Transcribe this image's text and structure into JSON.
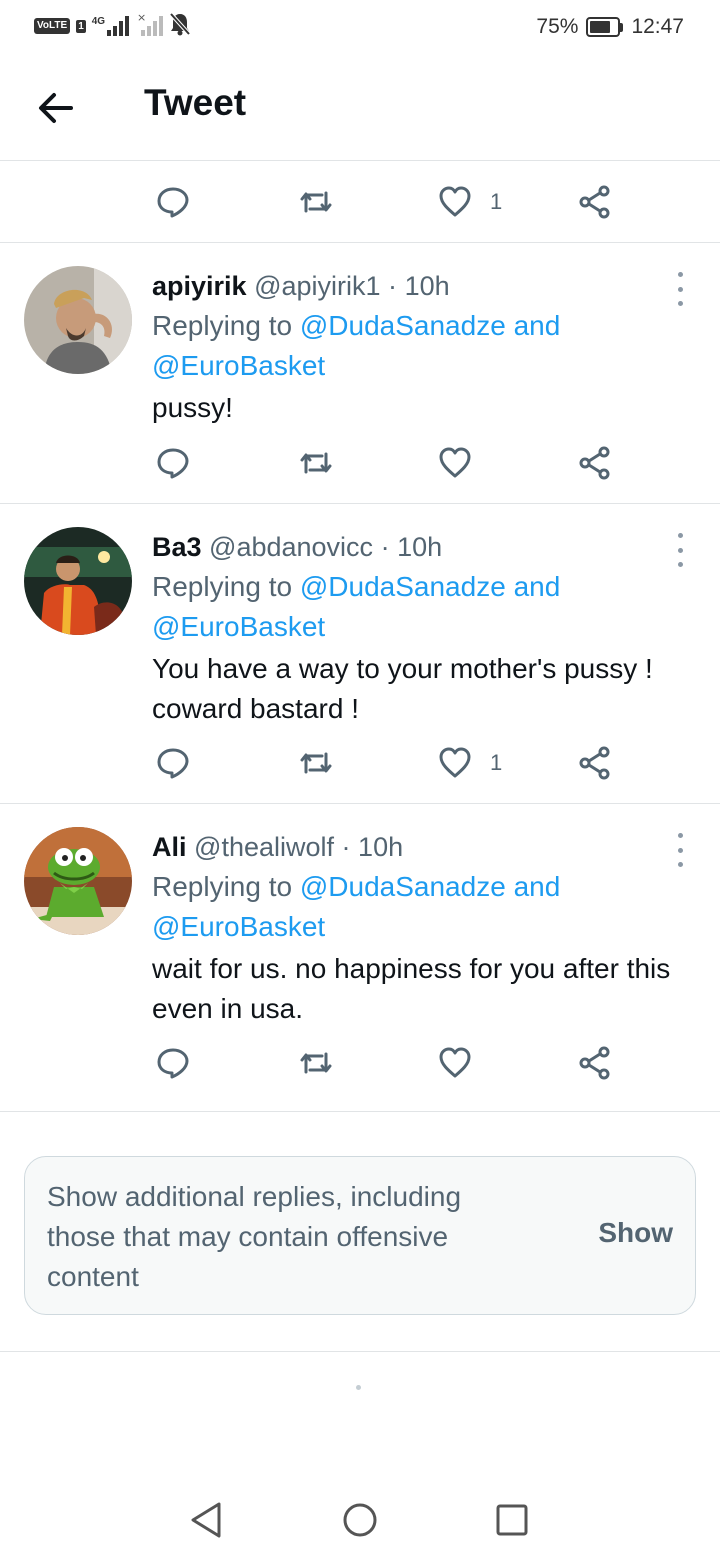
{
  "status_bar": {
    "volte": "VoLTE",
    "sim": "1",
    "network": "4G",
    "battery_percent": "75%",
    "battery_level": 0.75,
    "time": "12:47",
    "icons": [
      "signal-icon",
      "signal-off-icon",
      "mute-icon",
      "battery-icon"
    ]
  },
  "header": {
    "title": "Tweet",
    "back_icon": "arrow-left-icon"
  },
  "main_tweet_actions": {
    "like_count": "1"
  },
  "tweets": [
    {
      "name": "apiyirik",
      "handle": "@apiyirik1",
      "separator": "·",
      "time": "10h",
      "replying_prefix": "Replying to",
      "mention_1": "@DudaSanadze",
      "and": "and",
      "mention_2": "@EuroBasket",
      "text": "pussy!",
      "like_count": ""
    },
    {
      "name": "Ba3",
      "handle": "@abdanovicc",
      "separator": "·",
      "time": "10h",
      "replying_prefix": "Replying to",
      "mention_1": "@DudaSanadze",
      "and": "and",
      "mention_2": "@EuroBasket",
      "text": "You have a way to your mother's pussy ! coward bastard !",
      "like_count": "1"
    },
    {
      "name": "Ali",
      "handle": "@thealiwolf",
      "separator": "·",
      "time": "10h",
      "replying_prefix": "Replying to",
      "mention_1": "@DudaSanadze",
      "and": "and",
      "mention_2": "@EuroBasket",
      "text": "wait for us. no happiness for you after this even in usa.",
      "like_count": ""
    }
  ],
  "additional_replies": {
    "text": "Show additional replies, including those that may contain offensive content",
    "button": "Show"
  },
  "colors": {
    "text_primary": "#0f1419",
    "text_secondary": "#536471",
    "link": "#1d9bf0",
    "divider": "#e1e4e6",
    "card_bg": "#f7f9f9"
  },
  "nav_bar": {
    "icons": [
      "back-triangle-icon",
      "home-circle-icon",
      "recents-square-icon"
    ]
  }
}
